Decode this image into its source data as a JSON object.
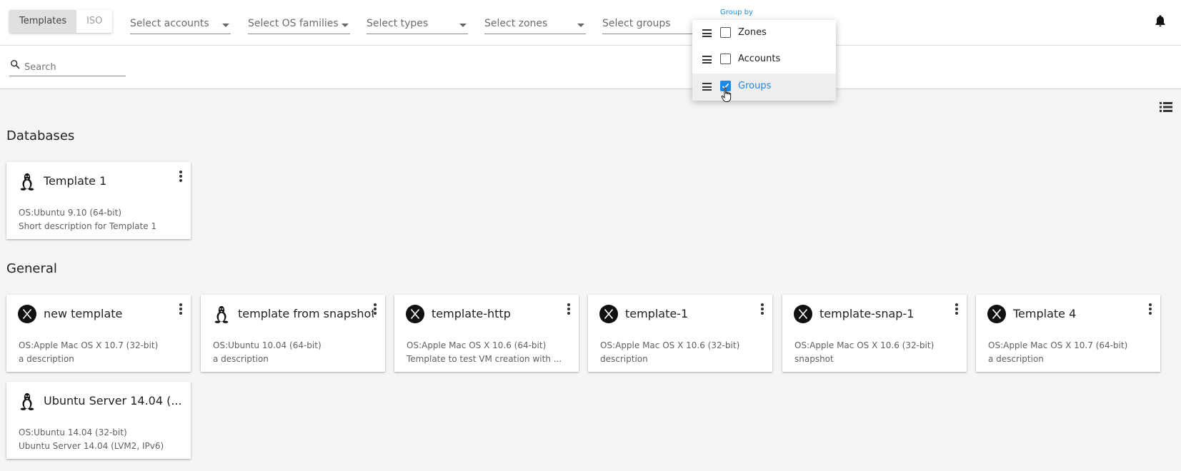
{
  "toolbar": {
    "tabs": [
      {
        "label": "Templates",
        "active": true
      },
      {
        "label": "ISO",
        "active": false
      }
    ],
    "filters": {
      "accounts": "Select accounts",
      "os_families": "Select OS families",
      "types": "Select types",
      "zones": "Select zones",
      "groups": "Select groups"
    }
  },
  "search": {
    "placeholder": "Search"
  },
  "group_by": {
    "label": "Group by",
    "options": [
      {
        "label": "Zones",
        "checked": false
      },
      {
        "label": "Accounts",
        "checked": false
      },
      {
        "label": "Groups",
        "checked": true
      }
    ]
  },
  "groups": [
    {
      "title": "Databases",
      "templates": [
        {
          "name": "Template 1",
          "os_icon": "linux-icon",
          "os": "OS:Ubuntu 9.10 (64-bit)",
          "description": "Short description for Template 1"
        }
      ]
    },
    {
      "title": "General",
      "templates": [
        {
          "name": "new template",
          "os_icon": "mac-os-x-icon",
          "os": "OS:Apple Mac OS X 10.7 (32-bit)",
          "description": "a description"
        },
        {
          "name": "template from snapshot",
          "os_icon": "linux-icon",
          "os": "OS:Ubuntu 10.04 (64-bit)",
          "description": "a description"
        },
        {
          "name": "template-http",
          "os_icon": "mac-os-x-icon",
          "os": "OS:Apple Mac OS X 10.6 (64-bit)",
          "description": "Template to test VM creation with ..."
        },
        {
          "name": "template-1",
          "os_icon": "mac-os-x-icon",
          "os": "OS:Apple Mac OS X 10.6 (32-bit)",
          "description": "description"
        },
        {
          "name": "template-snap-1",
          "os_icon": "mac-os-x-icon",
          "os": "OS:Apple Mac OS X 10.6 (32-bit)",
          "description": "snapshot"
        },
        {
          "name": "Template 4",
          "os_icon": "mac-os-x-icon",
          "os": "OS:Apple Mac OS X 10.7 (64-bit)",
          "description": "a description"
        },
        {
          "name": "Ubuntu Server 14.04 (...",
          "os_icon": "linux-icon",
          "os": "OS:Ubuntu 14.04 (32-bit)",
          "description": "Ubuntu Server 14.04 (LVM2, IPv6)"
        }
      ]
    }
  ],
  "colors": {
    "accent": "#1e88e5",
    "background": "#f5f5f5"
  }
}
